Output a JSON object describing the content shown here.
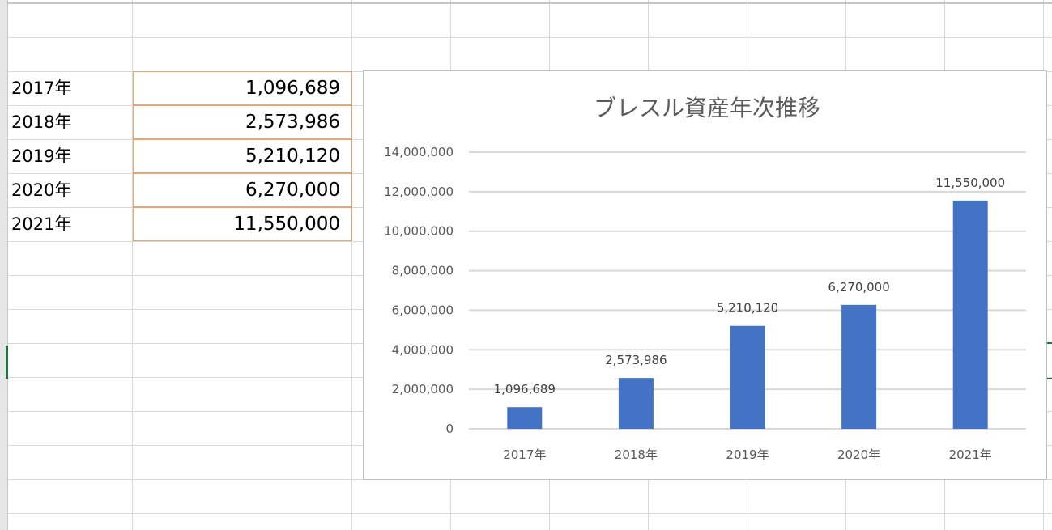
{
  "sheet": {
    "rows": [
      {
        "year": "2017年",
        "value": "1,096,689"
      },
      {
        "year": "2018年",
        "value": "2,573,986"
      },
      {
        "year": "2019年",
        "value": "5,210,120"
      },
      {
        "year": "2020年",
        "value": "6,270,000"
      },
      {
        "year": "2021年",
        "value": "11,550,000"
      }
    ]
  },
  "chart_data": {
    "type": "bar",
    "title": "ブレスル資産年次推移",
    "categories": [
      "2017年",
      "2018年",
      "2019年",
      "2020年",
      "2021年"
    ],
    "values": [
      1096689,
      2573986,
      5210120,
      6270000,
      11550000
    ],
    "data_labels": [
      "1,096,689",
      "2,573,986",
      "5,210,120",
      "6,270,000",
      "11,550,000"
    ],
    "y_ticks": [
      0,
      2000000,
      4000000,
      6000000,
      8000000,
      10000000,
      12000000,
      14000000
    ],
    "y_tick_labels": [
      "0",
      "2,000,000",
      "4,000,000",
      "6,000,000",
      "8,000,000",
      "10,000,000",
      "12,000,000",
      "14,000,000"
    ],
    "ylim": [
      0,
      14000000
    ],
    "grid": true,
    "legend": "none",
    "bar_color": "#4472c4",
    "gridline_color": "#d9d9d9",
    "text_color": "#595959"
  }
}
